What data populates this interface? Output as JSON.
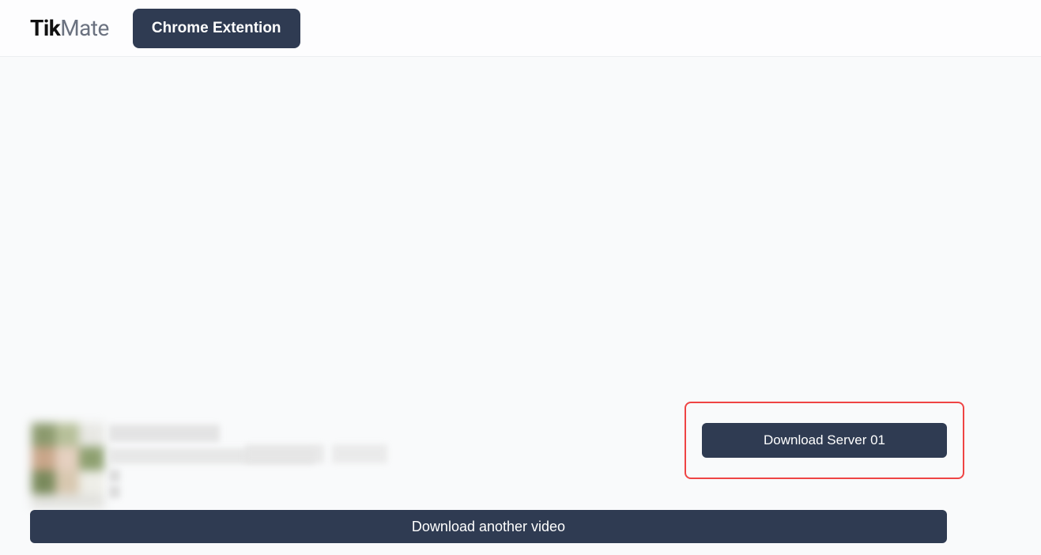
{
  "header": {
    "logo_bold": "Tik",
    "logo_rest": "Mate",
    "chrome_ext_label": "Chrome Extention"
  },
  "download": {
    "server_label": "Download Server 01",
    "another_label": "Download another video"
  }
}
